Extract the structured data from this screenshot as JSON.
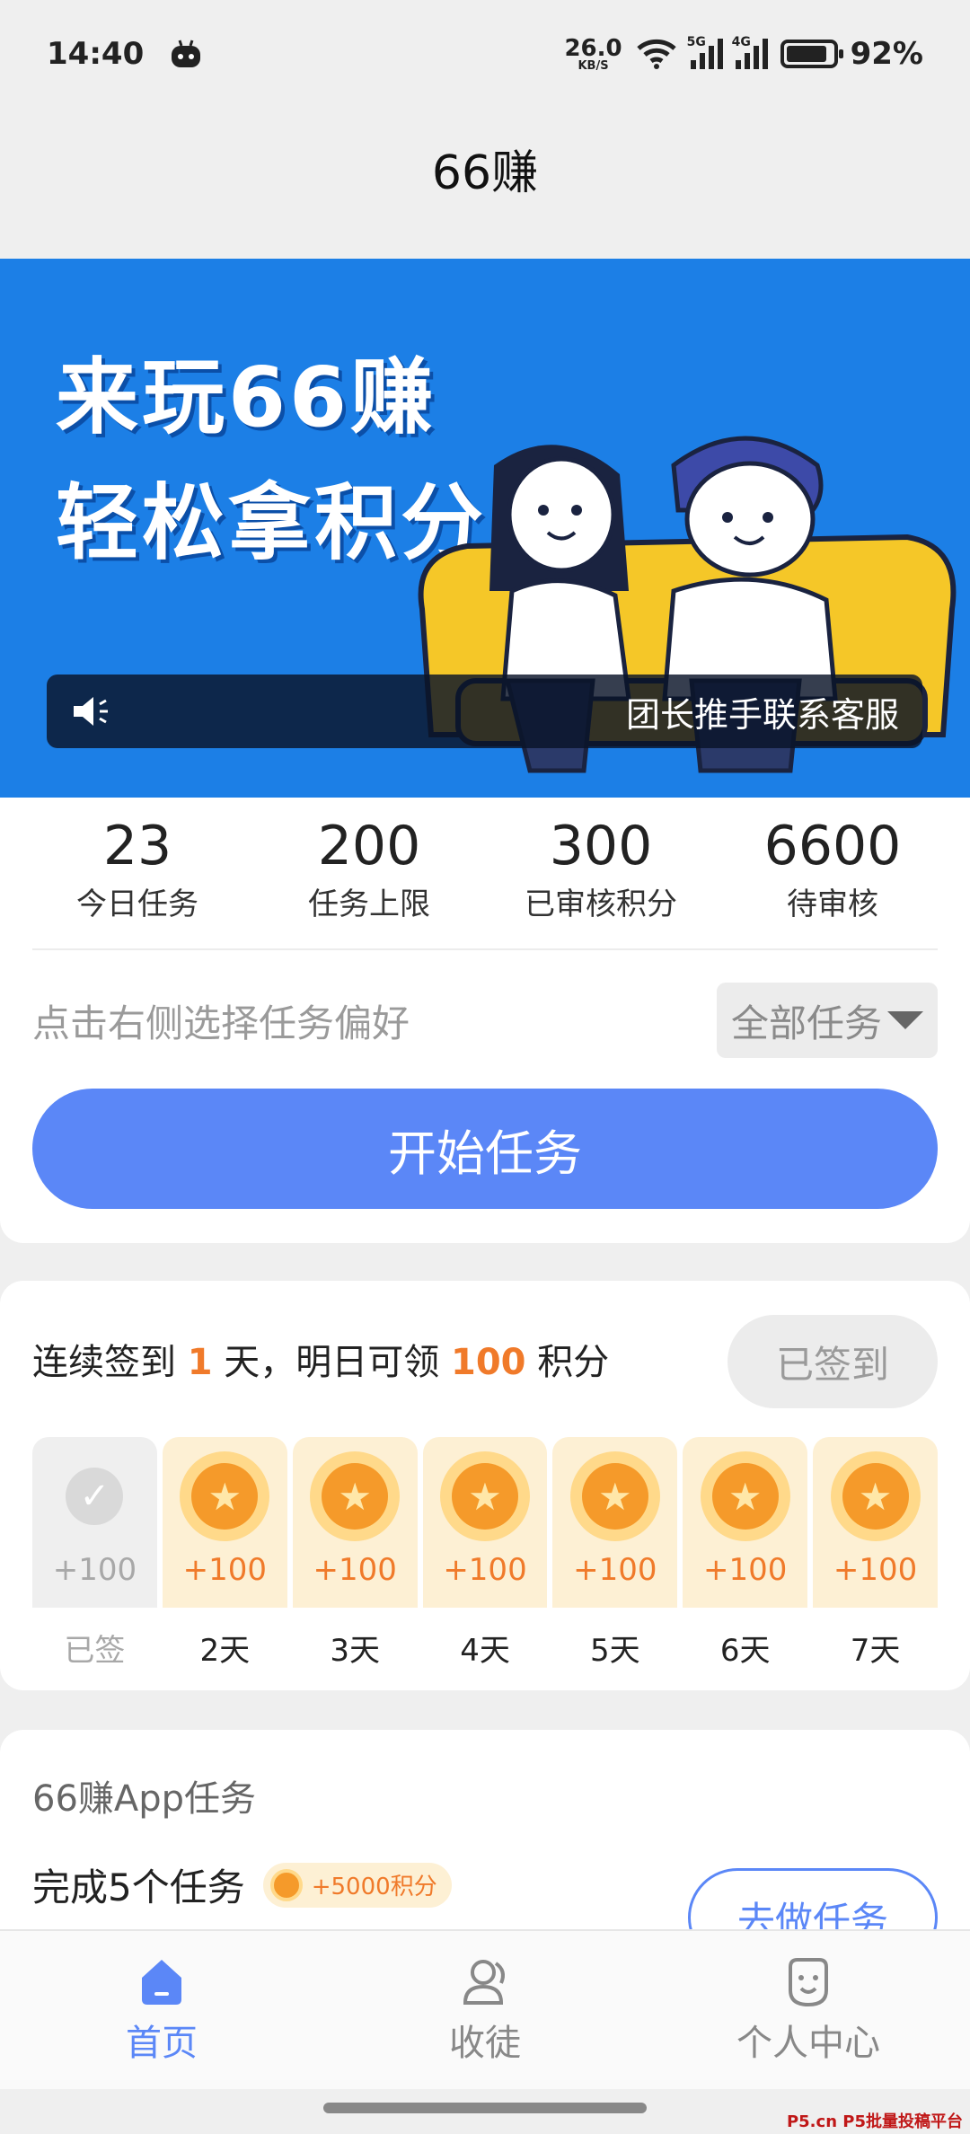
{
  "status": {
    "time": "14:40",
    "net_speed_value": "26.0",
    "net_speed_unit": "KB/S",
    "sig1_tag": "5G",
    "sig2_tag": "4G",
    "battery": "92%"
  },
  "header": {
    "title": "66赚"
  },
  "banner": {
    "line1": "来玩66赚",
    "line2": "轻松拿积分",
    "notice": "团长推手联系客服"
  },
  "stats": [
    {
      "value": "23",
      "label": "今日任务"
    },
    {
      "value": "200",
      "label": "任务上限"
    },
    {
      "value": "300",
      "label": "已审核积分"
    },
    {
      "value": "6600",
      "label": "待审核"
    }
  ],
  "preference": {
    "hint": "点击右侧选择任务偏好",
    "selected": "全部任务"
  },
  "start_button": "开始任务",
  "signin": {
    "prefix": "连续签到 ",
    "days": "1",
    "mid": " 天，明日可领 ",
    "points": "100",
    "suffix": " 积分",
    "button": "已签到",
    "days_list": [
      {
        "points": "+100",
        "label": "已签",
        "done": true
      },
      {
        "points": "+100",
        "label": "2天"
      },
      {
        "points": "+100",
        "label": "3天"
      },
      {
        "points": "+100",
        "label": "4天"
      },
      {
        "points": "+100",
        "label": "5天"
      },
      {
        "points": "+100",
        "label": "6天"
      },
      {
        "points": "+100",
        "label": "7天"
      }
    ],
    "check_glyph": "✓",
    "star_glyph": "★"
  },
  "app_task": {
    "section": "66赚App任务",
    "name": "完成5个任务",
    "reward": "+5000积分",
    "button": "去做任务"
  },
  "nav": {
    "items": [
      {
        "label": "首页",
        "icon": "home-icon",
        "active": true
      },
      {
        "label": "收徒",
        "icon": "person-icon"
      },
      {
        "label": "个人中心",
        "icon": "face-icon"
      }
    ]
  },
  "watermark": "P5.cn P5批量投稿平台",
  "colors": {
    "accent": "#5b87f7",
    "highlight": "#f07a2a",
    "banner_bg": "#1c7fe6"
  }
}
